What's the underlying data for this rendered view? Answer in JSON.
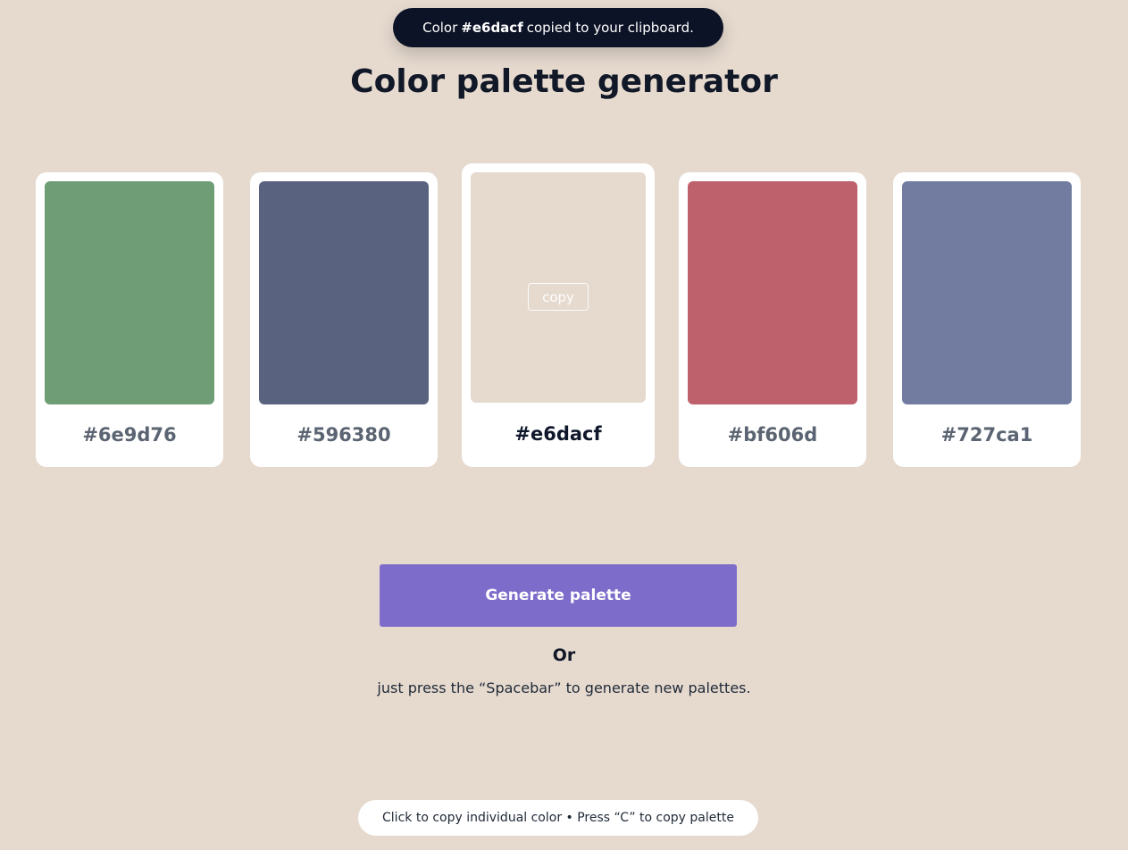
{
  "toast": {
    "prefix": "Color",
    "color": "#e6dacf",
    "suffix": "copied to your clipboard."
  },
  "title": "Color palette generator",
  "palette": [
    {
      "hex": "#6e9d76",
      "color": "#6e9d76"
    },
    {
      "hex": "#596380",
      "color": "#596380"
    },
    {
      "hex": "#e6dacf",
      "color": "#e6dacf",
      "copy_label": "copy"
    },
    {
      "hex": "#bf606d",
      "color": "#bf606d"
    },
    {
      "hex": "#727ca1",
      "color": "#727ca1"
    }
  ],
  "generate_button": {
    "label": "Generate palette",
    "color": "#7e6cca"
  },
  "or_text": "Or",
  "hint_text": "just press the “Spacebar” to generate new palettes.",
  "footer_text": "Click to copy individual color • Press “C” to copy palette"
}
